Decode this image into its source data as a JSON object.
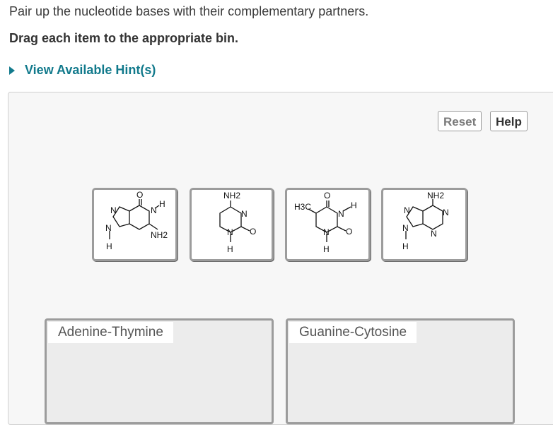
{
  "prompt": "Pair up the nucleotide bases with their complementary partners.",
  "instruction": "Drag each item to the appropriate bin.",
  "hints": {
    "label": "View Available Hint(s)",
    "icon": "caret-right-icon"
  },
  "toolbar": {
    "reset_label": "Reset",
    "help_label": "Help"
  },
  "tiles": [
    {
      "name": "guanine",
      "labels": {
        "o": "O",
        "h_top": "H",
        "n_top": "N",
        "n_left": "N",
        "n_bottom": "N",
        "nh2": "NH2",
        "h_bottom": "H"
      }
    },
    {
      "name": "cytosine",
      "labels": {
        "nh2": "NH2",
        "n_right": "N",
        "n_bottom": "N",
        "o": "O",
        "h_bottom": "H"
      }
    },
    {
      "name": "thymine",
      "labels": {
        "h3c": "H3C",
        "o_top": "O",
        "n_right": "N",
        "h_right": "H",
        "n_bottom": "N",
        "o_right": "O",
        "h_bottom": "H"
      }
    },
    {
      "name": "adenine",
      "labels": {
        "nh2": "NH2",
        "n_top_left": "N",
        "n_right": "N",
        "n_left": "N",
        "n_bottom": "N",
        "h_bottom": "H"
      }
    }
  ],
  "bins": [
    {
      "label": "Adenine-Thymine"
    },
    {
      "label": "Guanine-Cytosine"
    }
  ],
  "colors": {
    "hint_link": "#127a8c",
    "tile_border": "#9c9c9c",
    "bin_background": "#ececec"
  }
}
